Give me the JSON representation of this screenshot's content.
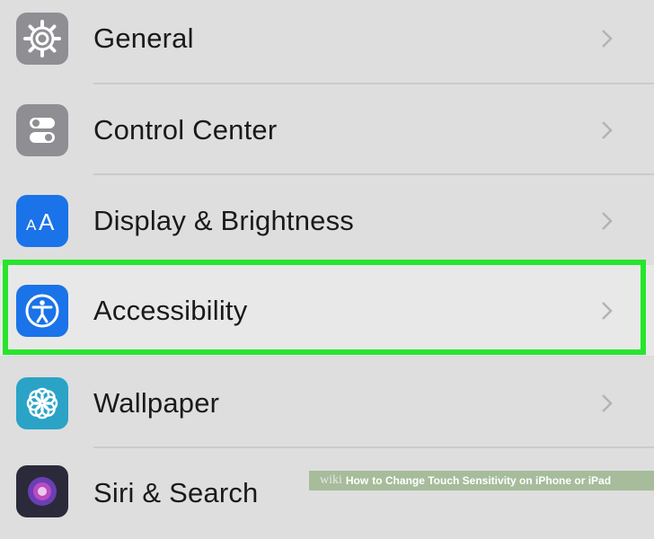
{
  "settings": {
    "items": [
      {
        "label": "General",
        "icon": "gear-icon",
        "icon_bg": "#8e8e93"
      },
      {
        "label": "Control Center",
        "icon": "toggles-icon",
        "icon_bg": "#8e8e93"
      },
      {
        "label": "Display & Brightness",
        "icon": "text-size-icon",
        "icon_bg": "#1a73e8"
      },
      {
        "label": "Accessibility",
        "icon": "accessibility-icon",
        "icon_bg": "#1a73e8",
        "highlighted": true
      },
      {
        "label": "Wallpaper",
        "icon": "flower-icon",
        "icon_bg": "#2aa3c7"
      },
      {
        "label": "Siri & Search",
        "icon": "siri-icon",
        "icon_bg": "#2a2a3a"
      }
    ]
  },
  "highlight_color": "#27e52c",
  "watermark": {
    "brand": "wiki",
    "how": "How",
    "title": "to Change Touch Sensitivity on iPhone or iPad"
  }
}
